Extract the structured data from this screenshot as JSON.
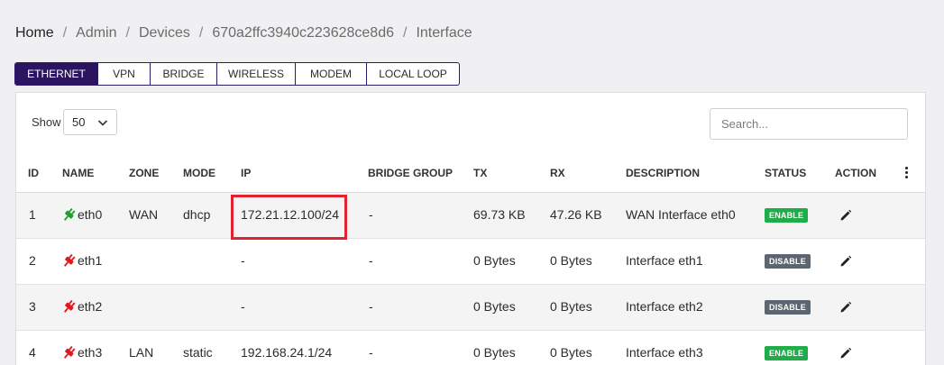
{
  "breadcrumb": [
    "Home",
    "Admin",
    "Devices",
    "670a2ffc3940c223628ce8d6",
    "Interface"
  ],
  "tabs": [
    {
      "label": "ETHERNET",
      "active": true
    },
    {
      "label": "VPN"
    },
    {
      "label": "BRIDGE"
    },
    {
      "label": "WIRELESS"
    },
    {
      "label": "MODEM"
    },
    {
      "label": "LOCAL LOOP"
    }
  ],
  "controls": {
    "show_label": "Show",
    "show_value": "50",
    "search_placeholder": "Search..."
  },
  "columns": [
    "ID",
    "NAME",
    "ZONE",
    "MODE",
    "IP",
    "BRIDGE GROUP",
    "TX",
    "RX",
    "DESCRIPTION",
    "STATUS",
    "ACTION"
  ],
  "rows": [
    {
      "id": "1",
      "name": "eth0",
      "link": "up",
      "zone": "WAN",
      "mode": "dhcp",
      "ip": "172.21.12.100/24",
      "bridge_group": "-",
      "tx": "69.73 KB",
      "rx": "47.26 KB",
      "description": "WAN Interface eth0",
      "status": "ENABLE"
    },
    {
      "id": "2",
      "name": "eth1",
      "link": "down",
      "zone": "",
      "mode": "",
      "ip": "-",
      "bridge_group": "-",
      "tx": "0 Bytes",
      "rx": "0 Bytes",
      "description": "Interface eth1",
      "status": "DISABLE"
    },
    {
      "id": "3",
      "name": "eth2",
      "link": "down",
      "zone": "",
      "mode": "",
      "ip": "-",
      "bridge_group": "-",
      "tx": "0 Bytes",
      "rx": "0 Bytes",
      "description": "Interface eth2",
      "status": "DISABLE"
    },
    {
      "id": "4",
      "name": "eth3",
      "link": "down",
      "zone": "LAN",
      "mode": "static",
      "ip": "192.168.24.1/24",
      "bridge_group": "-",
      "tx": "0 Bytes",
      "rx": "0 Bytes",
      "description": "Interface eth3",
      "status": "ENABLE"
    }
  ],
  "colors": {
    "accent": "#2c1461",
    "enable": "#1fad4a",
    "disable": "#5b6670",
    "link_up": "#1e9e2c",
    "link_down": "#e0191f",
    "highlight": "#e0232f"
  },
  "icons": {
    "link": "plug-icon",
    "action": "pencil-icon",
    "menu": "kebab-menu-icon",
    "select": "chevron-down-icon"
  }
}
